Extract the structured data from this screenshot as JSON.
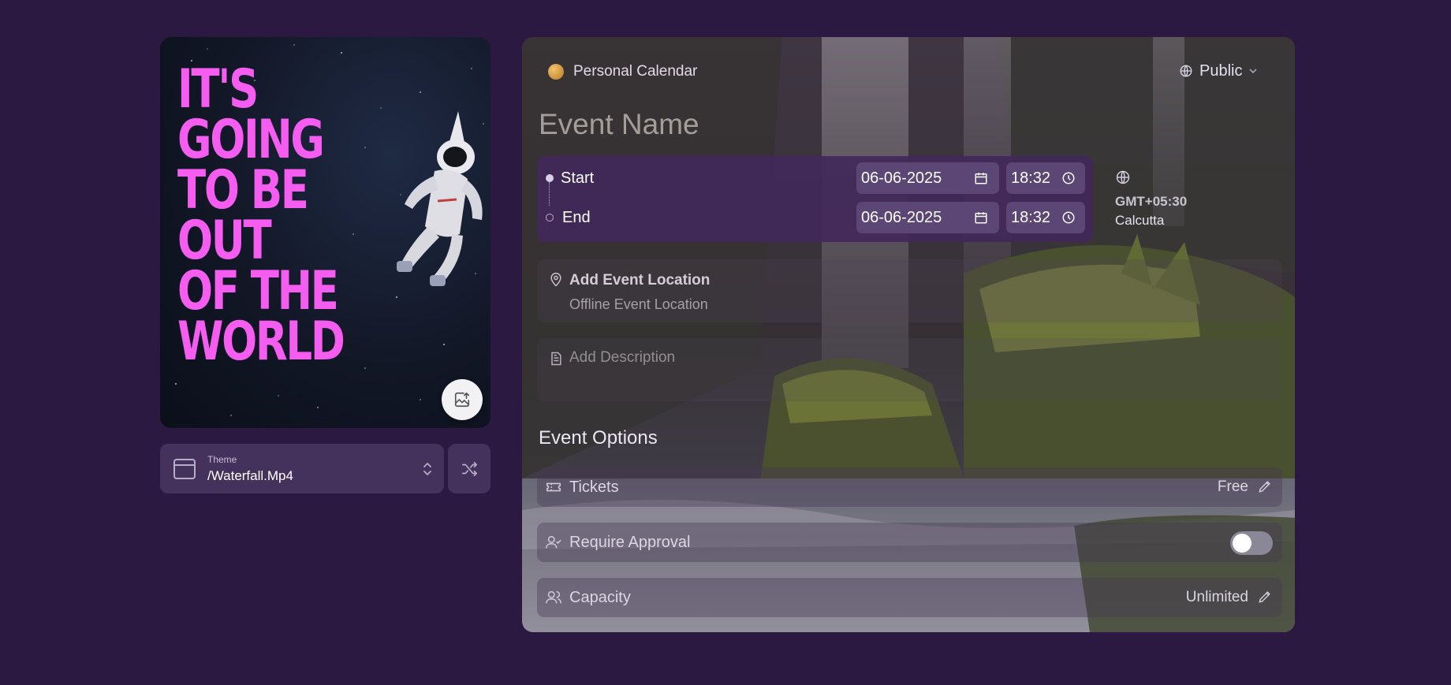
{
  "cover": {
    "lines": [
      "IT'S",
      "GOING",
      "TO BE",
      "OUT",
      "OF THE",
      "WORLD"
    ],
    "upload_icon": "image-upload-icon"
  },
  "theme": {
    "label": "Theme",
    "value": "/Waterfall.Mp4",
    "thumb_icon": "layout-icon",
    "chevron_icon": "chevron-up-down-icon",
    "shuffle_icon": "shuffle-icon"
  },
  "header": {
    "calendar": "Personal Calendar",
    "visibility": "Public"
  },
  "event": {
    "name_placeholder": "Event Name"
  },
  "schedule": {
    "start": {
      "label": "Start",
      "date": "06-06-2025",
      "time": "18:32"
    },
    "end": {
      "label": "End",
      "date": "06-06-2025",
      "time": "18:32"
    },
    "timezone": {
      "offset": "GMT+05:30",
      "city": "Calcutta"
    }
  },
  "location": {
    "title": "Add Event Location",
    "subtitle": "Offline Event Location"
  },
  "description": {
    "placeholder": "Add Description"
  },
  "options": {
    "title": "Event Options",
    "tickets": {
      "label": "Tickets",
      "value": "Free"
    },
    "approval": {
      "label": "Require Approval",
      "enabled": false
    },
    "capacity": {
      "label": "Capacity",
      "value": "Unlimited"
    }
  },
  "colors": {
    "page_bg": "#2b1942",
    "accent_pink": "#f45df0",
    "control_bg": "#45325c"
  }
}
